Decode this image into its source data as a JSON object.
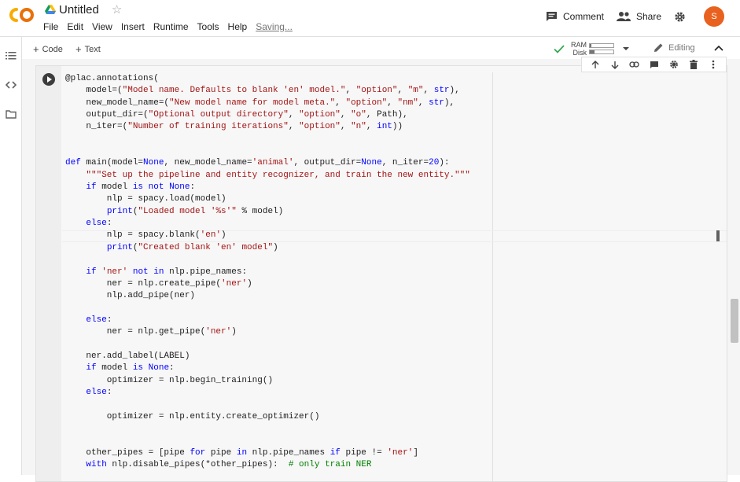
{
  "app": {
    "title": "Untitled",
    "menu": [
      "File",
      "Edit",
      "View",
      "Insert",
      "Runtime",
      "Tools",
      "Help"
    ],
    "saving": "Saving..."
  },
  "header": {
    "comment_label": "Comment",
    "share_label": "Share",
    "avatar_initial": "S",
    "avatar_color": "#e8611f"
  },
  "toolbar": {
    "add_code": "Code",
    "add_text": "Text",
    "ram_label": "RAM",
    "disk_label": "Disk",
    "ram_usage": 0.05,
    "disk_usage": 0.2,
    "editing_label": "Editing"
  },
  "code_lines": [
    "@plac.annotations(",
    "    model=(\"Model name. Defaults to blank 'en' model.\", \"option\", \"m\", str),",
    "    new_model_name=(\"New model name for model meta.\", \"option\", \"nm\", str),",
    "    output_dir=(\"Optional output directory\", \"option\", \"o\", Path),",
    "    n_iter=(\"Number of training iterations\", \"option\", \"n\", int))",
    "",
    "",
    "def main(model=None, new_model_name='animal', output_dir=None, n_iter=20):",
    "    \"\"\"Set up the pipeline and entity recognizer, and train the new entity.\"\"\"",
    "    if model is not None:",
    "        nlp = spacy.load(model)",
    "        print(\"Loaded model '%s'\" % model)",
    "    else:",
    "        nlp = spacy.blank('en')",
    "        print(\"Created blank 'en' model\")",
    "",
    "    if 'ner' not in nlp.pipe_names:",
    "        ner = nlp.create_pipe('ner')",
    "        nlp.add_pipe(ner)",
    "",
    "    else:",
    "        ner = nlp.get_pipe('ner')",
    "",
    "    ner.add_label(LABEL)",
    "    if model is None:",
    "        optimizer = nlp.begin_training()",
    "    else:",
    "",
    "        optimizer = nlp.entity.create_optimizer()",
    "",
    "",
    "    other_pipes = [pipe for pipe in nlp.pipe_names if pipe != 'ner']",
    "    with nlp.disable_pipes(*other_pipes):  # only train NER"
  ],
  "colors": {
    "keyword": "#0000ff",
    "string": "#a31515",
    "comment": "#008000",
    "logo_orange": "#f9ab00"
  }
}
